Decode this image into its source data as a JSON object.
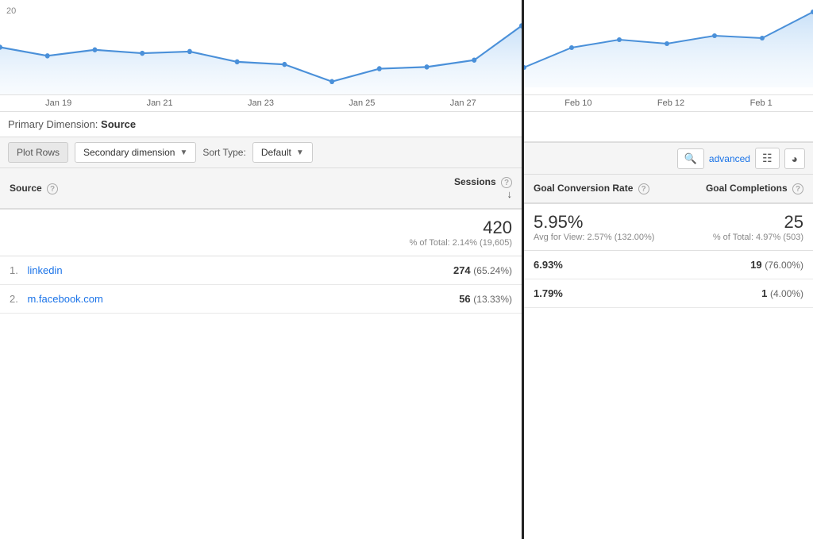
{
  "chart_left": {
    "x_labels": [
      "Jan 19",
      "Jan 21",
      "Jan 23",
      "Jan 25",
      "Jan 27"
    ],
    "y_label": "20"
  },
  "chart_right": {
    "x_labels": [
      "Feb 10",
      "Feb 12",
      "Feb 1"
    ]
  },
  "primary_dimension": {
    "label": "Primary Dimension:",
    "value": "Source"
  },
  "toolbar": {
    "plot_rows": "Plot Rows",
    "secondary_dimension": "Secondary dimension",
    "sort_label": "Sort Type:",
    "sort_value": "Default",
    "advanced": "advanced"
  },
  "table_left": {
    "col_source": "Source",
    "col_sessions": "Sessions",
    "col_sessions_sort_icon": "↓",
    "total": {
      "sessions_main": "420",
      "sessions_sub": "% of Total: 2.14% (19,605)"
    },
    "rows": [
      {
        "num": "1.",
        "name": "linkedin",
        "sessions": "274",
        "sessions_pct": "(65.24%)"
      },
      {
        "num": "2.",
        "name": "m.facebook.com",
        "sessions": "56",
        "sessions_pct": "(13.33%)"
      }
    ]
  },
  "table_right": {
    "col_goal_conversion": "Goal Conversion Rate",
    "col_goal_completions": "Goal Completions",
    "total": {
      "gcr_main": "5.95%",
      "gcr_sub": "Avg for View: 2.57% (132.00%)",
      "gc_main": "25",
      "gc_sub": "% of Total: 4.97% (503)"
    },
    "rows": [
      {
        "gcr": "6.93%",
        "gc": "19",
        "gc_pct": "(76.00%)"
      },
      {
        "gcr": "1.79%",
        "gc": "1",
        "gc_pct": "(4.00%)"
      }
    ]
  }
}
